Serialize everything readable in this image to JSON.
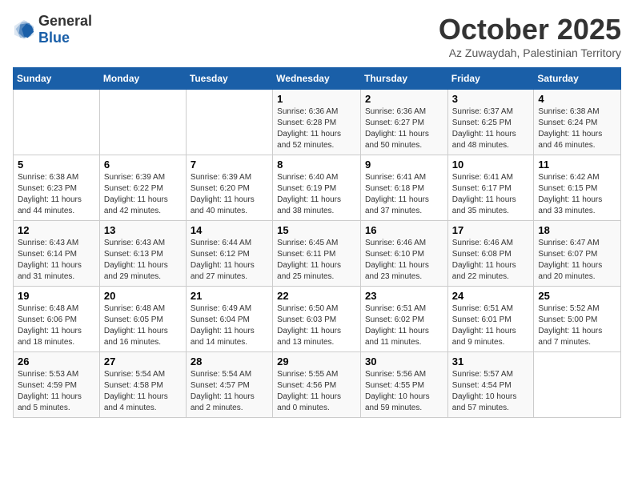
{
  "logo": {
    "general": "General",
    "blue": "Blue"
  },
  "title": "October 2025",
  "location": "Az Zuwaydah, Palestinian Territory",
  "weekdays": [
    "Sunday",
    "Monday",
    "Tuesday",
    "Wednesday",
    "Thursday",
    "Friday",
    "Saturday"
  ],
  "weeks": [
    [
      {
        "day": "",
        "info": ""
      },
      {
        "day": "",
        "info": ""
      },
      {
        "day": "",
        "info": ""
      },
      {
        "day": "1",
        "info": "Sunrise: 6:36 AM\nSunset: 6:28 PM\nDaylight: 11 hours and 52 minutes."
      },
      {
        "day": "2",
        "info": "Sunrise: 6:36 AM\nSunset: 6:27 PM\nDaylight: 11 hours and 50 minutes."
      },
      {
        "day": "3",
        "info": "Sunrise: 6:37 AM\nSunset: 6:25 PM\nDaylight: 11 hours and 48 minutes."
      },
      {
        "day": "4",
        "info": "Sunrise: 6:38 AM\nSunset: 6:24 PM\nDaylight: 11 hours and 46 minutes."
      }
    ],
    [
      {
        "day": "5",
        "info": "Sunrise: 6:38 AM\nSunset: 6:23 PM\nDaylight: 11 hours and 44 minutes."
      },
      {
        "day": "6",
        "info": "Sunrise: 6:39 AM\nSunset: 6:22 PM\nDaylight: 11 hours and 42 minutes."
      },
      {
        "day": "7",
        "info": "Sunrise: 6:39 AM\nSunset: 6:20 PM\nDaylight: 11 hours and 40 minutes."
      },
      {
        "day": "8",
        "info": "Sunrise: 6:40 AM\nSunset: 6:19 PM\nDaylight: 11 hours and 38 minutes."
      },
      {
        "day": "9",
        "info": "Sunrise: 6:41 AM\nSunset: 6:18 PM\nDaylight: 11 hours and 37 minutes."
      },
      {
        "day": "10",
        "info": "Sunrise: 6:41 AM\nSunset: 6:17 PM\nDaylight: 11 hours and 35 minutes."
      },
      {
        "day": "11",
        "info": "Sunrise: 6:42 AM\nSunset: 6:15 PM\nDaylight: 11 hours and 33 minutes."
      }
    ],
    [
      {
        "day": "12",
        "info": "Sunrise: 6:43 AM\nSunset: 6:14 PM\nDaylight: 11 hours and 31 minutes."
      },
      {
        "day": "13",
        "info": "Sunrise: 6:43 AM\nSunset: 6:13 PM\nDaylight: 11 hours and 29 minutes."
      },
      {
        "day": "14",
        "info": "Sunrise: 6:44 AM\nSunset: 6:12 PM\nDaylight: 11 hours and 27 minutes."
      },
      {
        "day": "15",
        "info": "Sunrise: 6:45 AM\nSunset: 6:11 PM\nDaylight: 11 hours and 25 minutes."
      },
      {
        "day": "16",
        "info": "Sunrise: 6:46 AM\nSunset: 6:10 PM\nDaylight: 11 hours and 23 minutes."
      },
      {
        "day": "17",
        "info": "Sunrise: 6:46 AM\nSunset: 6:08 PM\nDaylight: 11 hours and 22 minutes."
      },
      {
        "day": "18",
        "info": "Sunrise: 6:47 AM\nSunset: 6:07 PM\nDaylight: 11 hours and 20 minutes."
      }
    ],
    [
      {
        "day": "19",
        "info": "Sunrise: 6:48 AM\nSunset: 6:06 PM\nDaylight: 11 hours and 18 minutes."
      },
      {
        "day": "20",
        "info": "Sunrise: 6:48 AM\nSunset: 6:05 PM\nDaylight: 11 hours and 16 minutes."
      },
      {
        "day": "21",
        "info": "Sunrise: 6:49 AM\nSunset: 6:04 PM\nDaylight: 11 hours and 14 minutes."
      },
      {
        "day": "22",
        "info": "Sunrise: 6:50 AM\nSunset: 6:03 PM\nDaylight: 11 hours and 13 minutes."
      },
      {
        "day": "23",
        "info": "Sunrise: 6:51 AM\nSunset: 6:02 PM\nDaylight: 11 hours and 11 minutes."
      },
      {
        "day": "24",
        "info": "Sunrise: 6:51 AM\nSunset: 6:01 PM\nDaylight: 11 hours and 9 minutes."
      },
      {
        "day": "25",
        "info": "Sunrise: 5:52 AM\nSunset: 5:00 PM\nDaylight: 11 hours and 7 minutes."
      }
    ],
    [
      {
        "day": "26",
        "info": "Sunrise: 5:53 AM\nSunset: 4:59 PM\nDaylight: 11 hours and 5 minutes."
      },
      {
        "day": "27",
        "info": "Sunrise: 5:54 AM\nSunset: 4:58 PM\nDaylight: 11 hours and 4 minutes."
      },
      {
        "day": "28",
        "info": "Sunrise: 5:54 AM\nSunset: 4:57 PM\nDaylight: 11 hours and 2 minutes."
      },
      {
        "day": "29",
        "info": "Sunrise: 5:55 AM\nSunset: 4:56 PM\nDaylight: 11 hours and 0 minutes."
      },
      {
        "day": "30",
        "info": "Sunrise: 5:56 AM\nSunset: 4:55 PM\nDaylight: 10 hours and 59 minutes."
      },
      {
        "day": "31",
        "info": "Sunrise: 5:57 AM\nSunset: 4:54 PM\nDaylight: 10 hours and 57 minutes."
      },
      {
        "day": "",
        "info": ""
      }
    ]
  ]
}
